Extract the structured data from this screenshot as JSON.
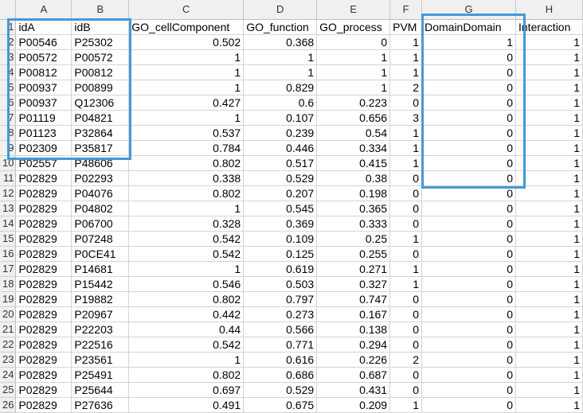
{
  "column_letters": [
    "A",
    "B",
    "C",
    "D",
    "E",
    "F",
    "G",
    "H"
  ],
  "headers": [
    "idA",
    "idB",
    "GO_cellComponent",
    "GO_function",
    "GO_process",
    "PVM",
    "DomainDomain",
    "Interaction"
  ],
  "row_numbers": [
    "1",
    "2",
    "3",
    "4",
    "5",
    "6",
    "7",
    "8",
    "9",
    "10",
    "11",
    "12",
    "13",
    "14",
    "15",
    "16",
    "17",
    "18",
    "19",
    "20",
    "21",
    "22",
    "23",
    "24",
    "25",
    "26"
  ],
  "rows": [
    [
      "P00546",
      "P25302",
      "0.502",
      "0.368",
      "0",
      "1",
      "1",
      "1"
    ],
    [
      "P00572",
      "P00572",
      "1",
      "1",
      "1",
      "1",
      "0",
      "1"
    ],
    [
      "P00812",
      "P00812",
      "1",
      "1",
      "1",
      "1",
      "0",
      "1"
    ],
    [
      "P00937",
      "P00899",
      "1",
      "0.829",
      "1",
      "2",
      "0",
      "1"
    ],
    [
      "P00937",
      "Q12306",
      "0.427",
      "0.6",
      "0.223",
      "0",
      "0",
      "1"
    ],
    [
      "P01119",
      "P04821",
      "1",
      "0.107",
      "0.656",
      "3",
      "0",
      "1"
    ],
    [
      "P01123",
      "P32864",
      "0.537",
      "0.239",
      "0.54",
      "1",
      "0",
      "1"
    ],
    [
      "P02309",
      "P35817",
      "0.784",
      "0.446",
      "0.334",
      "1",
      "0",
      "1"
    ],
    [
      "P02557",
      "P48606",
      "0.802",
      "0.517",
      "0.415",
      "1",
      "0",
      "1"
    ],
    [
      "P02829",
      "P02293",
      "0.338",
      "0.529",
      "0.38",
      "0",
      "0",
      "1"
    ],
    [
      "P02829",
      "P04076",
      "0.802",
      "0.207",
      "0.198",
      "0",
      "0",
      "1"
    ],
    [
      "P02829",
      "P04802",
      "1",
      "0.545",
      "0.365",
      "0",
      "0",
      "1"
    ],
    [
      "P02829",
      "P06700",
      "0.328",
      "0.369",
      "0.333",
      "0",
      "0",
      "1"
    ],
    [
      "P02829",
      "P07248",
      "0.542",
      "0.109",
      "0.25",
      "1",
      "0",
      "1"
    ],
    [
      "P02829",
      "P0CE41",
      "0.542",
      "0.125",
      "0.255",
      "0",
      "0",
      "1"
    ],
    [
      "P02829",
      "P14681",
      "1",
      "0.619",
      "0.271",
      "1",
      "0",
      "1"
    ],
    [
      "P02829",
      "P15442",
      "0.546",
      "0.503",
      "0.327",
      "1",
      "0",
      "1"
    ],
    [
      "P02829",
      "P19882",
      "0.802",
      "0.797",
      "0.747",
      "0",
      "0",
      "1"
    ],
    [
      "P02829",
      "P20967",
      "0.442",
      "0.273",
      "0.167",
      "0",
      "0",
      "1"
    ],
    [
      "P02829",
      "P22203",
      "0.44",
      "0.566",
      "0.138",
      "0",
      "0",
      "1"
    ],
    [
      "P02829",
      "P22516",
      "0.542",
      "0.771",
      "0.294",
      "0",
      "0",
      "1"
    ],
    [
      "P02829",
      "P23561",
      "1",
      "0.616",
      "0.226",
      "2",
      "0",
      "1"
    ],
    [
      "P02829",
      "P25491",
      "0.802",
      "0.686",
      "0.687",
      "0",
      "0",
      "1"
    ],
    [
      "P02829",
      "P25644",
      "0.697",
      "0.529",
      "0.431",
      "0",
      "0",
      "1"
    ],
    [
      "P02829",
      "P27636",
      "0.491",
      "0.675",
      "0.209",
      "1",
      "0",
      "1"
    ]
  ],
  "highlight_color": "#4499d6"
}
